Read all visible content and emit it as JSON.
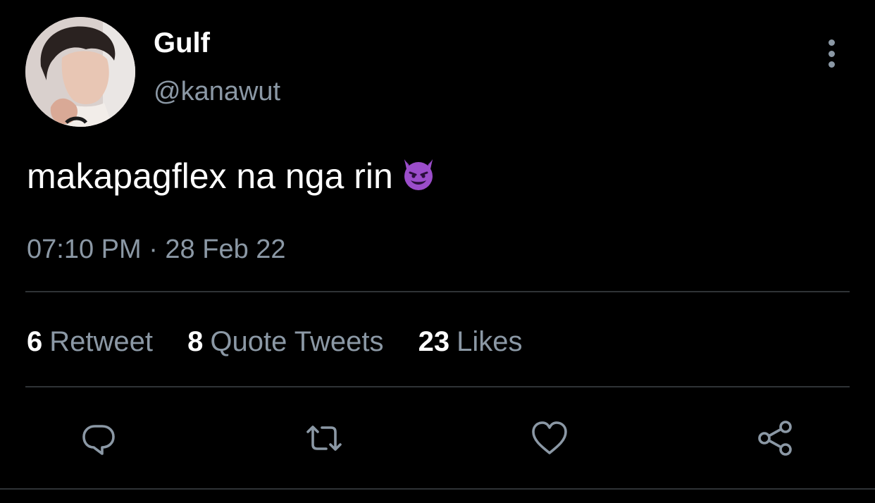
{
  "user": {
    "display_name": "Gulf",
    "handle": "@kanawut",
    "avatar_icon": "profile-photo"
  },
  "tweet": {
    "text": "makapagflex na nga rin",
    "emoji": "smiling-face-with-horns",
    "timestamp": "07:10 PM · 28 Feb 22"
  },
  "stats": [
    {
      "count": "6",
      "label": "Retweet"
    },
    {
      "count": "8",
      "label": "Quote Tweets"
    },
    {
      "count": "23",
      "label": "Likes"
    }
  ],
  "actions": {
    "reply_icon": "reply-icon",
    "retweet_icon": "retweet-icon",
    "like_icon": "heart-icon",
    "share_icon": "share-icon"
  },
  "colors": {
    "background": "#000000",
    "primary_text": "#ffffff",
    "secondary_text": "#8b98a5",
    "divider": "#2f3336",
    "emoji_purple": "#9b4dca"
  }
}
